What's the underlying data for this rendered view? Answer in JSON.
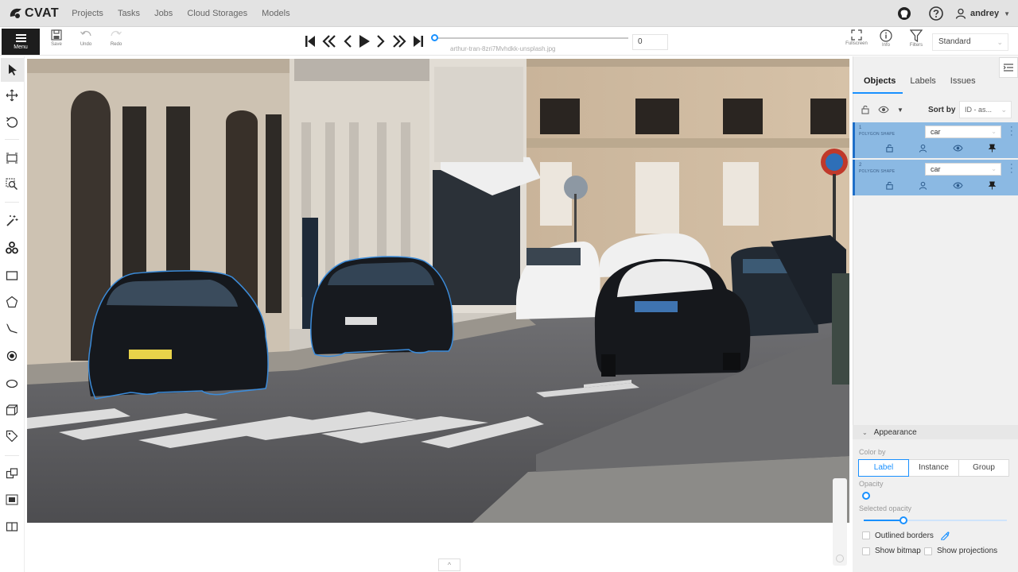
{
  "app": {
    "logo_text": "CVAT",
    "nav": [
      "Projects",
      "Tasks",
      "Jobs",
      "Cloud Storages",
      "Models"
    ],
    "user": "andrey"
  },
  "toolbar": {
    "menu_label": "Menu",
    "save_label": "Save",
    "undo_label": "Undo",
    "redo_label": "Redo",
    "frame_filename": "arthur-tran-8zri7Mvhdkk-unsplash.jpg",
    "frame_number": "0",
    "frame_progress": 0,
    "fullscreen_label": "Fullscreen",
    "info_label": "Info",
    "filters_label": "Filters",
    "workspace": "Standard"
  },
  "left_tools": [
    "cursor-icon",
    "move-icon",
    "rotate-icon",
    "fit-image-icon",
    "zoom-region-icon",
    "magic-wand-icon",
    "opencv-icon",
    "rectangle-icon",
    "polygon-icon",
    "polyline-icon",
    "points-icon",
    "ellipse-icon",
    "cuboid-icon",
    "tag-icon",
    "merge-icon",
    "group-icon",
    "split-icon"
  ],
  "sidebar": {
    "tabs": [
      "Objects",
      "Labels",
      "Issues"
    ],
    "active_tab": "Objects",
    "sort_label": "Sort by",
    "sort_value": "ID - as...",
    "objects": [
      {
        "id": "1",
        "type": "POLYGON SHAPE",
        "label": "car"
      },
      {
        "id": "2",
        "type": "POLYGON SHAPE",
        "label": "car"
      }
    ],
    "accent_color": "#1890ff",
    "object_color": "#8bb9e3"
  },
  "appearance": {
    "title": "Appearance",
    "color_by_label": "Color by",
    "color_by_options": [
      "Label",
      "Instance",
      "Group"
    ],
    "color_by_selected": "Label",
    "opacity_label": "Opacity",
    "opacity_value": 0,
    "selected_opacity_label": "Selected opacity",
    "selected_opacity_value": 0.4,
    "outlined_borders_label": "Outlined borders",
    "show_bitmap_label": "Show bitmap",
    "show_projections_label": "Show projections"
  }
}
